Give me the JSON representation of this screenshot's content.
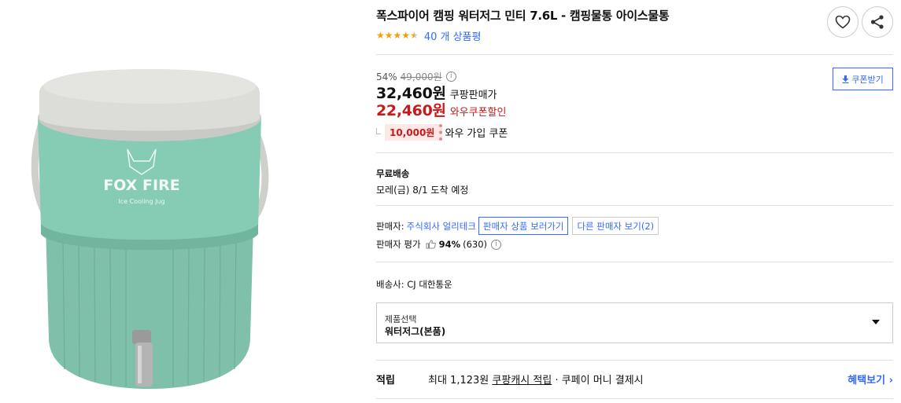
{
  "product": {
    "title": "폭스파이어 캠핑 워터저그 민티 7.6L - 캠핑물통 아이스물통",
    "rating": 4.5,
    "review_count_text": "40 개 상품평",
    "image_brand_text": "FOX FIRE",
    "image_sub_text": "Ice Cooling Jug"
  },
  "actions": {
    "heart_icon": "heart-icon",
    "share_icon": "share-icon"
  },
  "price": {
    "discount_rate": "54%",
    "original_price": "49,000원",
    "info_mark": "i",
    "sale_price": "32,460원",
    "sale_label": "쿠팡판매가",
    "wow_price": "22,460원",
    "wow_label": "와우쿠폰할인",
    "coupon_amount": "10,000원",
    "coupon_label": "와우 가입 쿠폰",
    "coupon_button_label": "쿠폰받기"
  },
  "shipping": {
    "title": "무료배송",
    "eta": "모레(금) 8/1 도착 예정"
  },
  "seller": {
    "label": "판매자:",
    "name": "주식회사 얼리테크",
    "view_products_label": "판매자 상품 보러가기",
    "other_sellers_label": "다른 판매자 보기",
    "other_sellers_count": "(2)",
    "rating_label": "판매자 평가",
    "rating_percent": "94%",
    "rating_count": "(630)"
  },
  "carrier": {
    "text": "배송사:  CJ 대한통운"
  },
  "option": {
    "label": "제품선택",
    "selected": "워터저그(본품)"
  },
  "reward": {
    "title": "적립",
    "prefix": "최대 1,123원 ",
    "link": "쿠팡캐시 적립",
    "suffix": " · 쿠페이 머니 결제시",
    "more_label": "혜택보기 ›"
  },
  "colors": {
    "accent_blue": "#346aff",
    "price_red": "#c81a1a",
    "star": "#f59e0b",
    "jug_body": "#7fc4ad",
    "jug_lid": "#d9d9d6"
  }
}
